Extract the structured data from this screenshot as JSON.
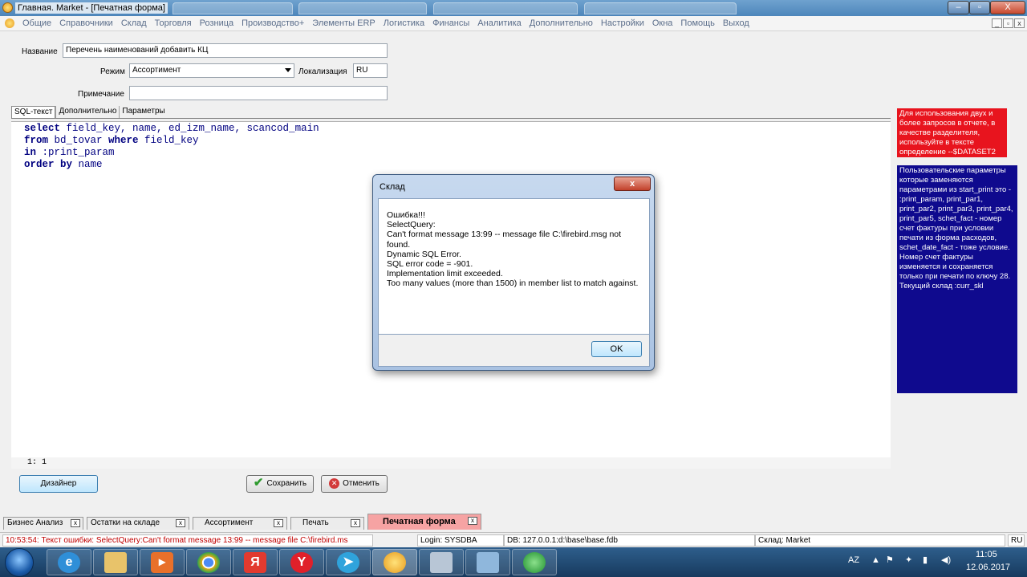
{
  "window": {
    "title": "Главная. Market - [Печатная форма]",
    "controls": {
      "minimize": "–",
      "restore": "▫",
      "close": "X"
    }
  },
  "menu": {
    "items": [
      "Общие",
      "Справочники",
      "Склад",
      "Торговля",
      "Розница",
      "Производство+",
      "Элементы ERP",
      "Логистика",
      "Финансы",
      "Аналитика",
      "Дополнительно",
      "Настройки",
      "Окна",
      "Помощь",
      "Выход"
    ],
    "mdi_controls": {
      "minimize": "_",
      "restore": "▫",
      "close": "x"
    }
  },
  "form": {
    "name_label": "Название",
    "name_value": "Перечень наименований добавить КЦ",
    "mode_label": "Режим",
    "mode_value": "Ассортимент",
    "localization_label": "Локализация",
    "localization_value": "RU",
    "note_label": "Примечание",
    "note_value": ""
  },
  "tabs": [
    "SQL-текст",
    "Дополнительно",
    "Параметры"
  ],
  "editor": {
    "lines": [
      {
        "kw": "select",
        "rest": " field_key, name, ed_izm_name, scancod_main"
      },
      {
        "kw": "from",
        "rest": " bd_tovar ",
        "kw2": "where",
        "rest2": " field_key"
      },
      {
        "kw": "in",
        "rest": " :print_param"
      },
      {
        "kw": "order by",
        "rest": " name"
      }
    ],
    "cursor_pos": "1: 1"
  },
  "buttons": {
    "designer": "Дизайнер",
    "save": "Сохранить",
    "cancel": "Отменить"
  },
  "hints": {
    "red": "Для использования двух и более запросов в отчете, в качестве разделителя, используйте в тексте определение --$DATASET2",
    "blue": "Пользовательские параметры которые заменяются параметрами из start_print это - :print_param, print_par1, print_par2, print_par3, print_par4, print_par5, schet_fact - номер счет фактуры при условии печати из форма расходов, schet_date_fact - тоже условие. Номер счет фактуры изменяется и сохраняется только при печати по ключу 28. Текущий склад :curr_skl"
  },
  "dialog": {
    "title": "Склад",
    "close": "x",
    "lines": [
      "Ошибка!!!",
      "SelectQuery:",
      "Can't format message 13:99 -- message file C:\\firebird.msg not found.",
      "Dynamic SQL Error.",
      "SQL error code = -901.",
      "Implementation limit exceeded.",
      "Too many values (more than 1500) in member list to match against."
    ],
    "ok": "OK"
  },
  "doc_tabs": [
    "Бизнес Анализ",
    "Остатки на складе",
    "Ассортимент",
    "Печать",
    "Печатная форма"
  ],
  "doc_tab_close": "x",
  "status": {
    "message": "10:53:54: Текст ошибки: SelectQuery:Can't format message 13:99 -- message file C:\\firebird.ms",
    "login": "Login: SYSDBA",
    "db": "DB: 127.0.0.1:d:\\base\\base.fdb",
    "warehouse": "Склад: Market",
    "lang": "RU"
  },
  "taskbar": {
    "apps": [
      "ie-icon",
      "explorer-icon",
      "media-player-icon",
      "chrome-icon",
      "yandex-browser-icon",
      "yandex-icon",
      "telegram-icon",
      "market-app-icon",
      "calculator-icon",
      "notepad-icon",
      "green-app-icon"
    ],
    "tray": {
      "lang": "AZ",
      "time": "11:05",
      "date": "12.06.2017"
    }
  }
}
